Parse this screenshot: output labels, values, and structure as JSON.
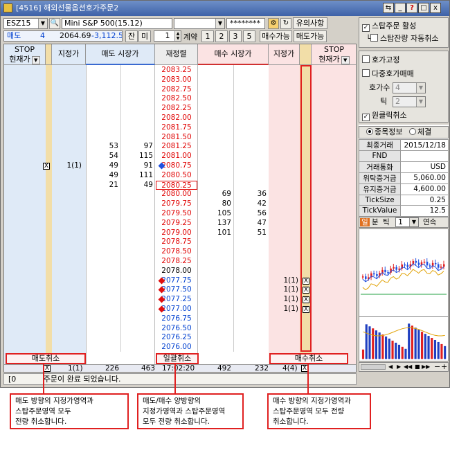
{
  "window": {
    "title": "[4516] 해외선물옵션호가주문2",
    "controls": [
      "_",
      "?",
      "□",
      "x"
    ]
  },
  "toolbar": {
    "symbol": "ESZ15",
    "contract_name": "Mini S&P 500(15.12)",
    "account_blank": "",
    "password_mask": "********",
    "notice_button": "유의사항",
    "side": "매도",
    "qty": "4",
    "avg_price": "2064.69",
    "pnl": "-3,112.50",
    "jan_label": "잔",
    "mi_label": "미",
    "lots": "1",
    "lots_unit": "계약",
    "quick_qty": [
      "1",
      "2",
      "3",
      "5"
    ],
    "buy_avail": "매수가능",
    "sell_avail": "매도가능"
  },
  "grid": {
    "headers": {
      "stop_left": "STOP",
      "stop_left_sub": "현재가",
      "limit_left": "지정가",
      "ask_market": "매도 시장가",
      "price": "재정렬",
      "bid_market": "매수 시장가",
      "limit_right": "지정가",
      "stop_right": "STOP",
      "stop_right_sub": "현재가"
    },
    "prices": [
      "2083.25",
      "2083.00",
      "2082.75",
      "2082.50",
      "2082.25",
      "2082.00",
      "2081.75",
      "2081.50",
      "2081.25",
      "2081.00",
      "2080.75",
      "2080.50",
      "2080.25",
      "2080.00",
      "2079.75",
      "2079.50",
      "2079.25",
      "2079.00",
      "2078.75",
      "2078.50",
      "2078.25",
      "2078.00",
      "2077.75",
      "2077.50",
      "2077.25",
      "2077.00",
      "2076.75",
      "2076.50",
      "2076.25",
      "2076.00"
    ],
    "asks": [
      {
        "row": 8,
        "count": "53",
        "qty": "97"
      },
      {
        "row": 9,
        "count": "54",
        "qty": "115"
      },
      {
        "row": 10,
        "count": "49",
        "qty": "91"
      },
      {
        "row": 11,
        "count": "49",
        "qty": "111"
      },
      {
        "row": 12,
        "count": "21",
        "qty": "49"
      }
    ],
    "bids": [
      {
        "row": 13,
        "qty": "69",
        "count": "36"
      },
      {
        "row": 14,
        "qty": "80",
        "count": "42"
      },
      {
        "row": 15,
        "qty": "105",
        "count": "56"
      },
      {
        "row": 16,
        "qty": "137",
        "count": "47"
      },
      {
        "row": 17,
        "qty": "101",
        "count": "51"
      }
    ],
    "left_order": {
      "row": 10,
      "text": "1(1)"
    },
    "right_orders": [
      {
        "row": 22,
        "text": "1(1)"
      },
      {
        "row": 23,
        "text": "1(1)"
      },
      {
        "row": 24,
        "text": "1(1)"
      },
      {
        "row": 25,
        "text": "1(1)"
      }
    ],
    "cancel": {
      "sell": "매도취소",
      "all": "일괄취소",
      "buy": "매수취소"
    },
    "summary": {
      "left_order": "1(1)",
      "ask_count": "226",
      "ask_qty": "463",
      "time": "17:02:20",
      "bid_qty": "492",
      "bid_count": "232",
      "right_order": "4(4)"
    },
    "x_mark": "X"
  },
  "status": {
    "code": "[0",
    "message": "주문이 완료 되었습니다."
  },
  "right_panel": {
    "stop_active": "스탑주문 활성",
    "stop_auto_cancel": "스탑잔량 자동취소",
    "fix_quote": "호가고정",
    "multi_quote": "다중호가매매",
    "quote_count_label": "호가수",
    "quote_count": "4",
    "tick_label": "틱",
    "tick_value": "2",
    "one_click_cancel": "원클릭취소",
    "tab_info": "종목정보",
    "tab_fill": "체결",
    "info": [
      [
        "최종거래",
        "2015/12/18"
      ],
      [
        "FND",
        ""
      ],
      [
        "거래통화",
        "USD"
      ],
      [
        "위탁증거금",
        "5,060.00"
      ],
      [
        "유지증거금",
        "4,600.00"
      ],
      [
        "TickSize",
        "0.25"
      ],
      [
        "TickValue",
        "12.5"
      ]
    ],
    "period_tabs": [
      "일",
      "분",
      "틱"
    ],
    "period_value": "1",
    "continuous": "연속"
  },
  "callouts": {
    "left": [
      "매도 방향의 지정가영역과",
      "스탑주문영역 모두",
      "전량 취소합니다."
    ],
    "middle": [
      "매도/매수 양방향의",
      "지정가영역과 스탑주문영역",
      "모두 전량 취소합니다."
    ],
    "right": [
      "매수 방향의 지정가영역과",
      "스탑주문영역 모두 전량",
      "취소합니다."
    ]
  },
  "colors": {
    "ask_bg": "#dfeaf7",
    "bid_bg": "#fbe3e3",
    "stop_bg": "#f2dea8",
    "highlight": "#e02020",
    "titlebar": "#3e62a8"
  }
}
